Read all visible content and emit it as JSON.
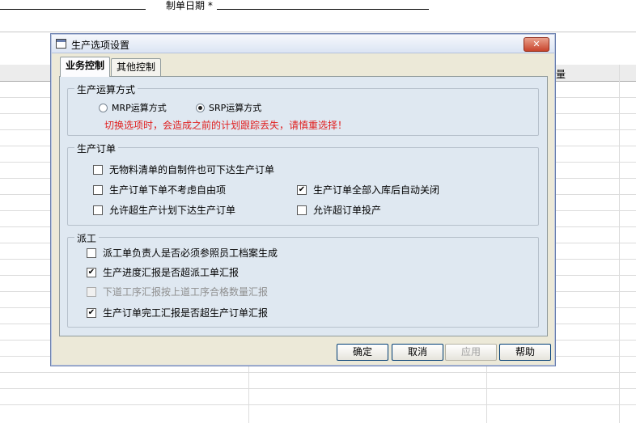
{
  "background": {
    "form_label": "制单日期 *",
    "grid_header_text": "量"
  },
  "dialog": {
    "title": "生产选项设置",
    "close_glyph": "✕",
    "tabs": [
      {
        "label": "业务控制",
        "active": true
      },
      {
        "label": "其他控制",
        "active": false
      }
    ],
    "calc_group": {
      "title": "生产运算方式",
      "options": [
        {
          "label": "MRP运算方式",
          "selected": false
        },
        {
          "label": "SRP运算方式",
          "selected": true
        }
      ],
      "warning": "切换选项时，会造成之前的计划跟踪丢失，请慎重选择！",
      "warning_color": "#e02020"
    },
    "order_group": {
      "title": "生产订单",
      "options": [
        {
          "label": "无物料清单的自制件也可下达生产订单",
          "checked": false
        },
        {
          "label": "生产订单下单不考虑自由项",
          "checked": false
        },
        {
          "label": "生产订单全部入库后自动关闭",
          "checked": true
        },
        {
          "label": "允许超生产计划下达生产订单",
          "checked": false
        },
        {
          "label": "允许超订单投产",
          "checked": false
        }
      ]
    },
    "dispatch_group": {
      "title": "派工",
      "options": [
        {
          "label": "派工单负责人是否必须参照员工档案生成",
          "checked": false,
          "enabled": true
        },
        {
          "label": "生产进度汇报是否超派工单汇报",
          "checked": true,
          "enabled": true
        },
        {
          "label": "下道工序汇报按上道工序合格数量汇报",
          "checked": false,
          "enabled": false
        },
        {
          "label": "生产订单完工汇报是否超生产订单汇报",
          "checked": true,
          "enabled": true
        }
      ]
    },
    "buttons": {
      "ok": "确定",
      "cancel": "取消",
      "apply": "应用",
      "help": "帮助"
    }
  }
}
